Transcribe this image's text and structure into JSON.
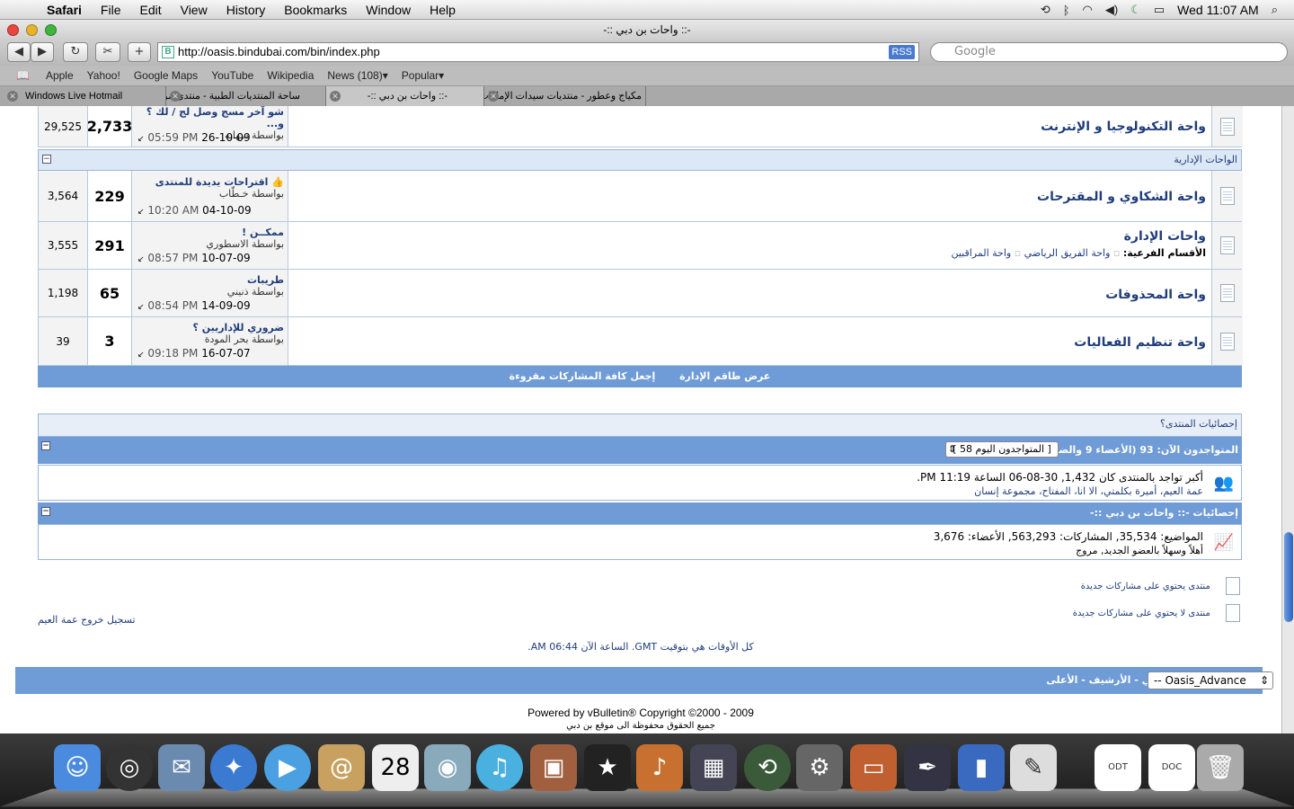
{
  "menubar": {
    "app": "Safari",
    "items": [
      "File",
      "Edit",
      "View",
      "History",
      "Bookmarks",
      "Window",
      "Help"
    ],
    "clock": "Wed 11:07 AM"
  },
  "window": {
    "title": "-:: واحات بن دبي ::-",
    "url": "http://oasis.bindubai.com/bin/index.php",
    "search_placeholder": "Google",
    "rss": "RSS"
  },
  "bookmarks": [
    "Apple",
    "Yahoo!",
    "Google Maps",
    "YouTube",
    "Wikipedia",
    "News (108)▾",
    "Popular▾"
  ],
  "tabs": [
    {
      "label": "Windows Live Hotmail"
    },
    {
      "label": "ساحة المنتديات الطبية - منتدى موقع ..."
    },
    {
      "label": "-:: واحات بن دبي ::-"
    },
    {
      "label": "مكياج وعطور - منتديات سيدات الإمارات"
    }
  ],
  "forums": [
    {
      "name": "واحة التكنولوجيا و الإنترنت",
      "last_title": "شو آخر مسج وصل لج / لك ؟ و...",
      "last_by": "بواسطة سهابه",
      "date": "26-10-09",
      "time": "05:59 PM",
      "threads": "2,733",
      "posts": "29,525"
    },
    {
      "name": "واحة الشكاوي و المقترحات",
      "last_title": "اقتراحات يديدة للمنتدى",
      "last_by": "بواسطة خـطّاب",
      "date": "04-10-09",
      "time": "10:20 AM",
      "threads": "229",
      "posts": "3,564"
    },
    {
      "name": "واحات الإدارة",
      "last_title": "ممكــن !",
      "last_by": "بواسطة الاسطوري",
      "date": "10-07-09",
      "time": "08:57 PM",
      "threads": "291",
      "posts": "3,555",
      "subforums_label": "الأقسام الفرعية:",
      "subforums": [
        "واحة الفريق الرياضي",
        "واحة المراقبين"
      ]
    },
    {
      "name": "واحة المحذوفات",
      "last_title": "طريبات",
      "last_by": "بواسطة ذنيني",
      "date": "14-09-09",
      "time": "08:54 PM",
      "threads": "65",
      "posts": "1,198"
    },
    {
      "name": "واحة تنظيم الفعاليات",
      "last_title": "ضروري للإداريين ؟",
      "last_by": "بواسطة بحر المودة",
      "date": "16-07-07",
      "time": "09:18 PM",
      "threads": "3",
      "posts": "39"
    }
  ],
  "category_admin": "الواحات الإدارية",
  "actions": {
    "mark_read": "إجعل كافة المشاركات مقروءة",
    "show_staff": "عرض طاقم الإدارة"
  },
  "stats": {
    "header": "إحصائيات المنتدى؟",
    "online_label": "المتواجدون الآن: 93 (الأعضاء 9 والضيوف 84)",
    "online_select": "[ المتواجدون اليوم 58 ]",
    "record": "أكبر تواجد بالمنتدى كان 1,432, 30-08-06 الساعة 11:19 PM.",
    "members_online": "عمة العيم، أميرة بكلمتي، الا انا، المفتاح، مجموعة إنسان",
    "site_stats_header": "إحصائيات -:: واحات بن دبي ::-",
    "site_stats": "المواضيع: 35,534, المشاركات: 563,293, الأعضاء: 3,676",
    "welcome": "أهلاً وسهلاً بالعضو الجديد, مروج"
  },
  "legend": {
    "new": "منتدى يحتوي على مشاركات جديدة",
    "no_new": "منتدى لا يحتوي على مشاركات جديدة"
  },
  "logout": "تسجيل خروج عمة العيم",
  "timezone": "كل الأوقات هي بتوقيت GMT. الساعة الآن 06:44 AM.",
  "footer_links": "إتصل بنا - موقع بن دبي - الأرشيف - الأعلى",
  "style_select": "-- Oasis_Advance",
  "powered": "Powered by vBulletin® Copyright ©2000 - 2009",
  "rights": "جميع الحقوق محفوظة الى موقع بن دبي",
  "colors": {
    "bar": "#6f9bd6",
    "link": "#1f3d7a"
  }
}
